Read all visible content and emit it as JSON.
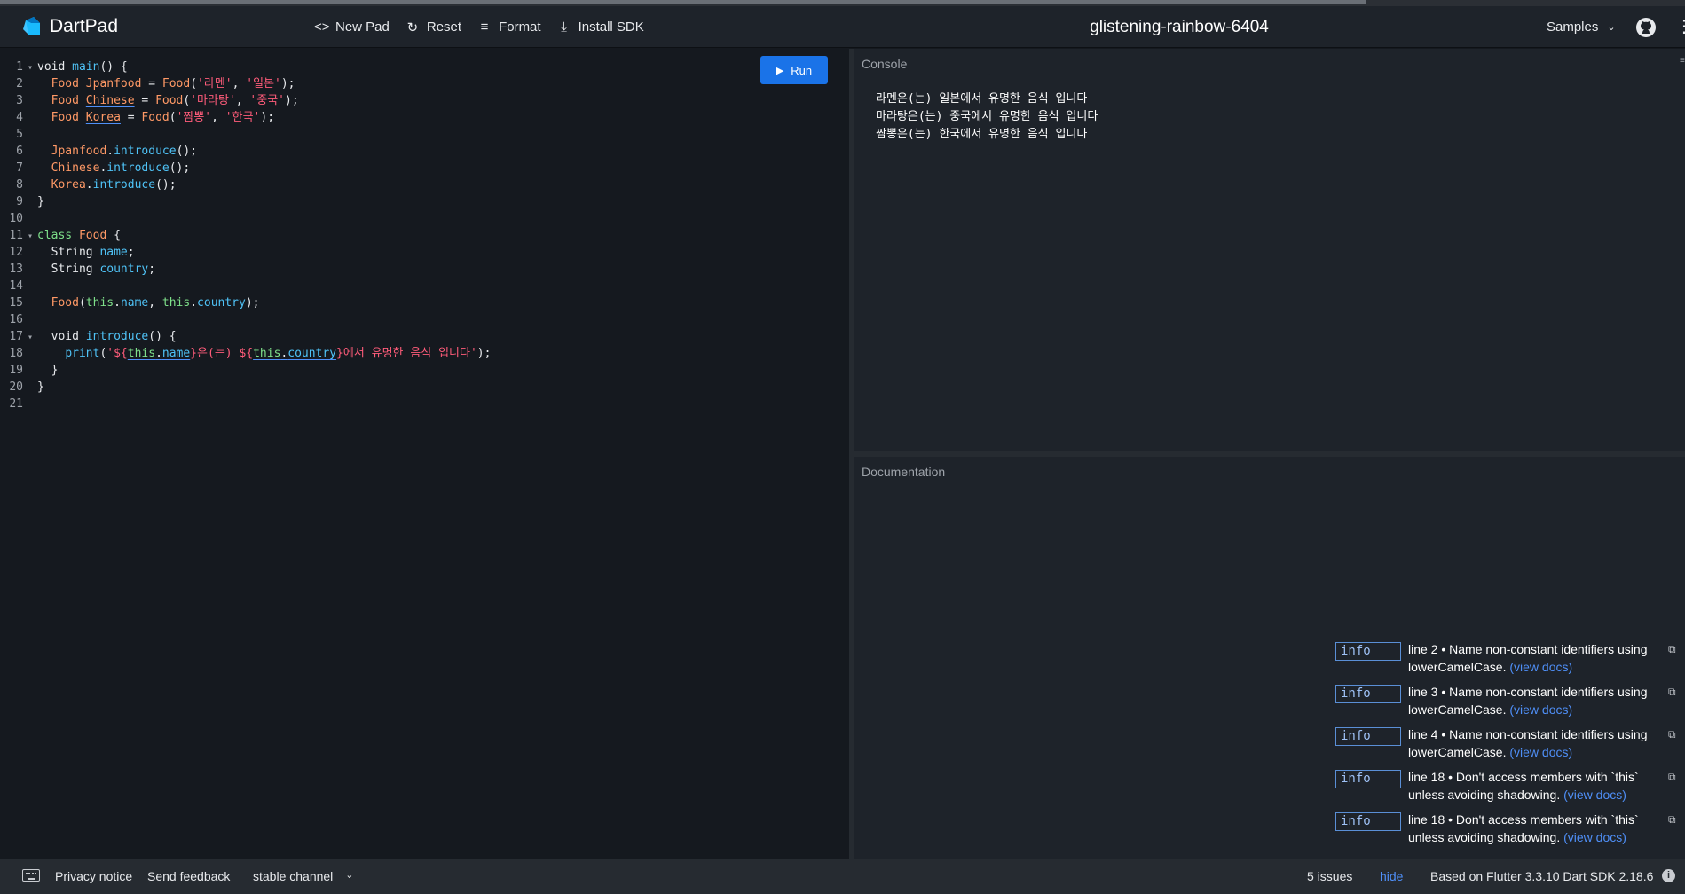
{
  "app": {
    "name": "DartPad",
    "pad_title": "glistening-rainbow-6404"
  },
  "toolbar": {
    "new_pad": "New Pad",
    "reset": "Reset",
    "format": "Format",
    "install_sdk": "Install SDK",
    "samples": "Samples"
  },
  "icons": {
    "new_pad": "code-brackets-icon",
    "reset": "refresh-icon",
    "format": "align-left-icon",
    "install_sdk": "download-icon",
    "github": "github-icon",
    "more": "kebab-menu-icon"
  },
  "run": {
    "label": "Run"
  },
  "editor": {
    "lines": [
      {
        "n": "1",
        "fold": "▾"
      },
      {
        "n": "2",
        "fold": ""
      },
      {
        "n": "3",
        "fold": ""
      },
      {
        "n": "4",
        "fold": ""
      },
      {
        "n": "5",
        "fold": ""
      },
      {
        "n": "6",
        "fold": ""
      },
      {
        "n": "7",
        "fold": ""
      },
      {
        "n": "8",
        "fold": ""
      },
      {
        "n": "9",
        "fold": ""
      },
      {
        "n": "10",
        "fold": ""
      },
      {
        "n": "11",
        "fold": "▾"
      },
      {
        "n": "12",
        "fold": ""
      },
      {
        "n": "13",
        "fold": ""
      },
      {
        "n": "14",
        "fold": ""
      },
      {
        "n": "15",
        "fold": ""
      },
      {
        "n": "16",
        "fold": ""
      },
      {
        "n": "17",
        "fold": "▾"
      },
      {
        "n": "18",
        "fold": ""
      },
      {
        "n": "19",
        "fold": ""
      },
      {
        "n": "20",
        "fold": ""
      },
      {
        "n": "21",
        "fold": ""
      }
    ],
    "tok": {
      "void": "void",
      "main": "main",
      "open_paren_close_brace": "() {",
      "food": "Food",
      "jpanfood": "Jpanfood",
      "chinese": "Chinese",
      "korea": "Korea",
      "eq_food": " = ",
      "food_call": "Food",
      "ramen": "'라멘'",
      "japan": "'일본'",
      "malatang": "'마라탕'",
      "china": "'중국'",
      "jjamppong": "'짬뽕'",
      "korea_str": "'한국'",
      "introduce": "introduce",
      "class": "class",
      "string": "String",
      "name": "name",
      "country": "country",
      "this": "this",
      "print": "print",
      "str_open": "'${",
      "str_mid": "}은(는) ${",
      "str_end": "}에서 유명한 음식 입니다'",
      "close_brace": "}"
    }
  },
  "console": {
    "label": "Console",
    "lines": [
      "라멘은(는) 일본에서 유명한 음식 입니다",
      "마라탕은(는) 중국에서 유명한 음식 입니다",
      "짬뽕은(는) 한국에서 유명한 음식 입니다"
    ]
  },
  "documentation": {
    "label": "Documentation"
  },
  "issues": [
    {
      "level": "info",
      "message": "line 2 • Name non-constant identifiers using lowerCamelCase.",
      "link": "(view docs)"
    },
    {
      "level": "info",
      "message": "line 3 • Name non-constant identifiers using lowerCamelCase.",
      "link": "(view docs)"
    },
    {
      "level": "info",
      "message": "line 4 • Name non-constant identifiers using lowerCamelCase.",
      "link": "(view docs)"
    },
    {
      "level": "info",
      "message": "line 18 • Don't access members with `this` unless avoiding shadowing.",
      "link": "(view docs)"
    },
    {
      "level": "info",
      "message": "line 18 • Don't access members with `this` unless avoiding shadowing.",
      "link": "(view docs)"
    }
  ],
  "footer": {
    "privacy": "Privacy notice",
    "feedback": "Send feedback",
    "channel": "stable channel",
    "issues_count": "5 issues",
    "hide": "hide",
    "version": "Based on Flutter 3.3.10 Dart SDK 2.18.6"
  },
  "colors": {
    "accent": "#1a73e8",
    "link": "#4f8ff7",
    "background": "#15191f",
    "panel": "#1e232a"
  }
}
